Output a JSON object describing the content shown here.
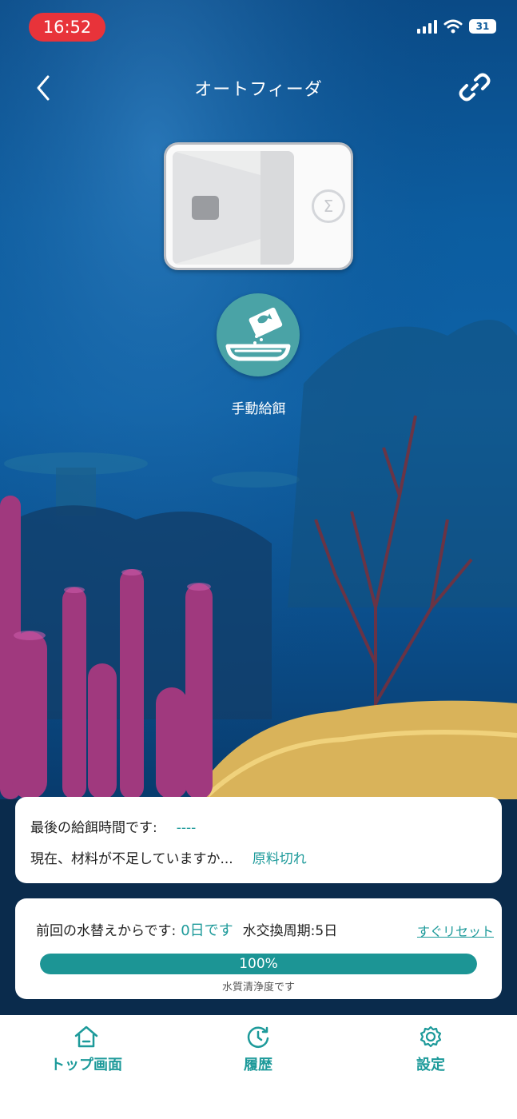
{
  "status_bar": {
    "time": "16:52",
    "battery": "31",
    "time_pill_color": "#e8333a"
  },
  "header": {
    "title": "オートフィーダ",
    "back_icon": "chevron-left-icon",
    "link_icon": "link-icon"
  },
  "device": {
    "logo_glyph": "Σ"
  },
  "manual_feed": {
    "label": "手動給餌",
    "icon": "feeding-icon",
    "color": "#4aa3a6"
  },
  "feeding_info": {
    "last_feed_label": "最後の給餌時間です:",
    "last_feed_value": "----",
    "material_label": "現在、材料が不足していますか...",
    "material_value": "原料切れ"
  },
  "water": {
    "since_label": "前回の水替えからです:",
    "since_value": "0日です",
    "cycle_label": "水交換周期:5日",
    "reset_label": "すぐリセット",
    "purity_percent": 100,
    "purity_text": "100%",
    "purity_caption": "水質清浄度です",
    "accent_color": "#1c9595"
  },
  "tabs": [
    {
      "label": "トップ画面",
      "icon": "home-icon"
    },
    {
      "label": "履歴",
      "icon": "history-icon"
    },
    {
      "label": "設定",
      "icon": "gear-icon"
    }
  ]
}
